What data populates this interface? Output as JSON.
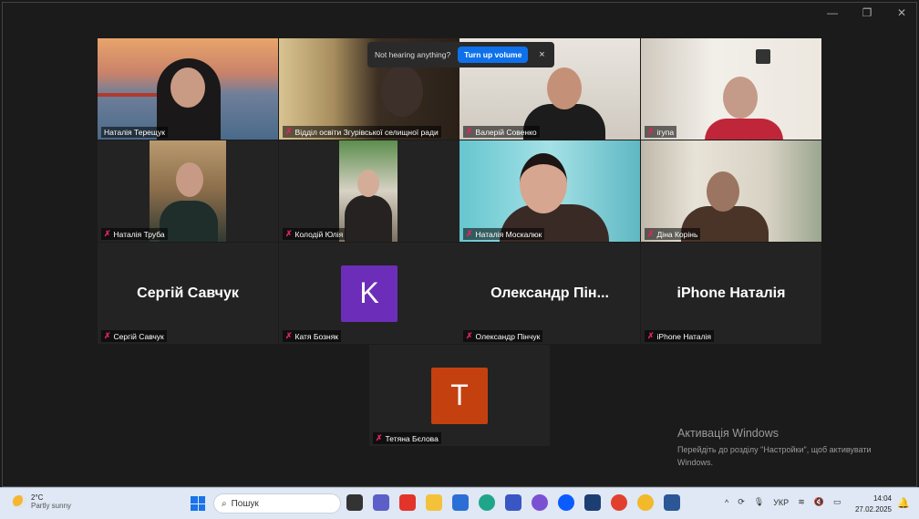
{
  "banner": {
    "text": "Not hearing anything?",
    "button": "Turn up volume",
    "close": "×"
  },
  "window_controls": [
    "—",
    "❐",
    "✕"
  ],
  "participants": [
    {
      "name": "Наталія Терещук",
      "muted": false,
      "active": true
    },
    {
      "name": "Відділ освіти Згурівської селищної ради",
      "muted": true
    },
    {
      "name": "Валерій Совенко",
      "muted": true
    },
    {
      "name": "ігупа",
      "muted": true
    },
    {
      "name": "Наталія Труба",
      "muted": true
    },
    {
      "name": "Колодій Юлія",
      "muted": true
    },
    {
      "name": "Наталія Москалюк",
      "muted": true
    },
    {
      "name": "Діна Корінь",
      "muted": true
    },
    {
      "name": "Сергій Савчук",
      "display": "Сергій Савчук",
      "muted": true
    },
    {
      "name": "Катя Бозняк",
      "avatar": "K",
      "avatar_color": "#6c2eb8",
      "muted": true
    },
    {
      "name": "Олександр Пінчук",
      "display": "Олександр  Пін...",
      "muted": true
    },
    {
      "name": "iPhone Наталія",
      "display": "iPhone Наталія",
      "muted": true
    },
    {
      "name": "Тетяна Бєлова",
      "avatar": "T",
      "avatar_color": "#c5400f",
      "muted": true
    }
  ],
  "activation": {
    "title": "Активація Windows",
    "line1": "Перейдіть до розділу \"Настройки\", щоб активувати",
    "line2": "Windows."
  },
  "taskbar": {
    "weather_temp": "2°C",
    "weather_cond": "Partly sunny",
    "search_placeholder": "Пошук",
    "lang": "УКР",
    "time": "14:04",
    "date": "27.02.2025"
  }
}
